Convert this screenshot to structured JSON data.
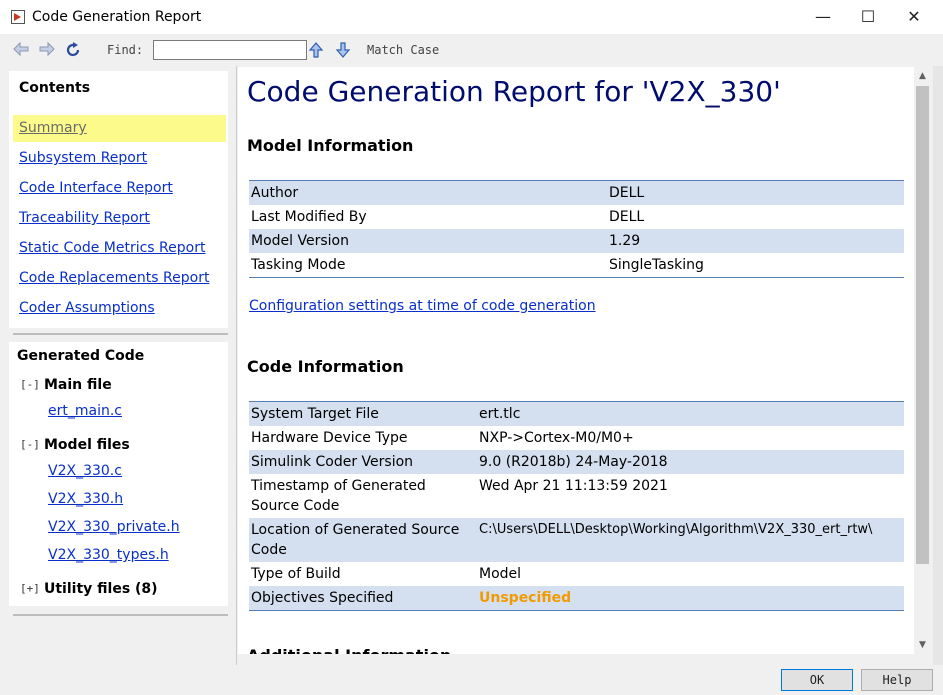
{
  "window": {
    "title": "Code Generation Report",
    "minimize": "—",
    "maximize": "☐",
    "close": "✕"
  },
  "toolbar": {
    "back_icon": "arrow-left-icon",
    "forward_icon": "arrow-right-icon",
    "refresh_icon": "refresh-icon",
    "find_label": "Find:",
    "find_value": "",
    "find_up_icon": "arrow-up-icon",
    "find_down_icon": "arrow-down-icon",
    "match_case": "Match Case"
  },
  "contents": {
    "heading": "Contents",
    "items": [
      {
        "label": "Summary",
        "selected": true
      },
      {
        "label": "Subsystem Report"
      },
      {
        "label": "Code Interface Report"
      },
      {
        "label": "Traceability Report"
      },
      {
        "label": "Static Code Metrics Report"
      },
      {
        "label": "Code Replacements Report"
      },
      {
        "label": "Coder Assumptions"
      }
    ]
  },
  "generated_code": {
    "heading": "Generated Code",
    "groups": [
      {
        "toggle": "[-]",
        "label": "Main file",
        "files": [
          "ert_main.c"
        ]
      },
      {
        "toggle": "[-]",
        "label": "Model files",
        "files": [
          "V2X_330.c",
          "V2X_330.h",
          "V2X_330_private.h",
          "V2X_330_types.h"
        ]
      },
      {
        "toggle": "[+]",
        "label": "Utility files (8)",
        "files": []
      }
    ]
  },
  "report": {
    "title": "Code Generation Report for 'V2X_330'",
    "model_info": {
      "heading": "Model Information",
      "rows": [
        [
          "Author",
          "DELL"
        ],
        [
          "Last Modified By",
          "DELL"
        ],
        [
          "Model Version",
          "1.29"
        ],
        [
          "Tasking Mode",
          "SingleTasking"
        ]
      ]
    },
    "config_link": "Configuration settings at time of code generation",
    "code_info": {
      "heading": "Code Information",
      "rows": [
        [
          "System Target File",
          "ert.tlc"
        ],
        [
          "Hardware Device Type",
          "NXP->Cortex-M0/M0+"
        ],
        [
          "Simulink Coder Version",
          "9.0 (R2018b) 24-May-2018"
        ],
        [
          "Timestamp of Generated Source Code",
          "Wed Apr 21 11:13:59 2021"
        ],
        [
          "Location of Generated Source Code",
          "C:\\Users\\DELL\\Desktop\\Working\\Algorithm\\V2X_330_ert_rtw\\"
        ],
        [
          "Type of Build",
          "Model"
        ],
        [
          "Objectives Specified",
          "Unspecified"
        ]
      ]
    },
    "additional_heading": "Additional Information"
  },
  "buttons": {
    "ok": "OK",
    "help": "Help"
  },
  "colors": {
    "link": "#0a2fc9",
    "title": "#000c6e",
    "highlight": "#fdfa8c",
    "row_band": "#d4dfef",
    "unspecified": "#f29b00"
  }
}
